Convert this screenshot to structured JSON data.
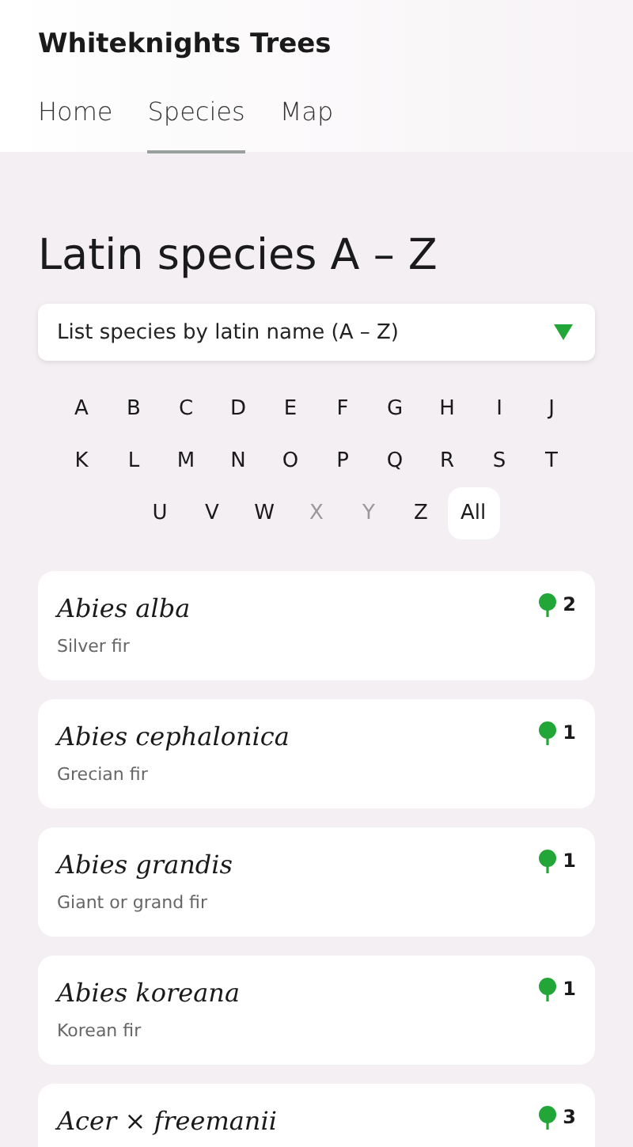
{
  "site_title": "Whiteknights Trees",
  "nav": [
    {
      "label": "Home",
      "selected": false
    },
    {
      "label": "Species",
      "selected": true
    },
    {
      "label": "Map",
      "selected": false
    }
  ],
  "heading": "Latin species A – Z",
  "sort_select": {
    "value": "List species by latin name (A – Z)"
  },
  "letters": [
    {
      "label": "A",
      "disabled": false,
      "selected": false
    },
    {
      "label": "B",
      "disabled": false,
      "selected": false
    },
    {
      "label": "C",
      "disabled": false,
      "selected": false
    },
    {
      "label": "D",
      "disabled": false,
      "selected": false
    },
    {
      "label": "E",
      "disabled": false,
      "selected": false
    },
    {
      "label": "F",
      "disabled": false,
      "selected": false
    },
    {
      "label": "G",
      "disabled": false,
      "selected": false
    },
    {
      "label": "H",
      "disabled": false,
      "selected": false
    },
    {
      "label": "I",
      "disabled": false,
      "selected": false
    },
    {
      "label": "J",
      "disabled": false,
      "selected": false
    },
    {
      "label": "K",
      "disabled": false,
      "selected": false
    },
    {
      "label": "L",
      "disabled": false,
      "selected": false
    },
    {
      "label": "M",
      "disabled": false,
      "selected": false
    },
    {
      "label": "N",
      "disabled": false,
      "selected": false
    },
    {
      "label": "O",
      "disabled": false,
      "selected": false
    },
    {
      "label": "P",
      "disabled": false,
      "selected": false
    },
    {
      "label": "Q",
      "disabled": false,
      "selected": false
    },
    {
      "label": "R",
      "disabled": false,
      "selected": false
    },
    {
      "label": "S",
      "disabled": false,
      "selected": false
    },
    {
      "label": "T",
      "disabled": false,
      "selected": false
    },
    {
      "label": "U",
      "disabled": false,
      "selected": false
    },
    {
      "label": "V",
      "disabled": false,
      "selected": false
    },
    {
      "label": "W",
      "disabled": false,
      "selected": false
    },
    {
      "label": "X",
      "disabled": true,
      "selected": false
    },
    {
      "label": "Y",
      "disabled": true,
      "selected": false
    },
    {
      "label": "Z",
      "disabled": false,
      "selected": false
    },
    {
      "label": "All",
      "disabled": false,
      "selected": true
    }
  ],
  "species": [
    {
      "latin": "Abies alba",
      "common": "Silver fir",
      "count": "2"
    },
    {
      "latin": "Abies cephalonica",
      "common": "Grecian fir",
      "count": "1"
    },
    {
      "latin": "Abies grandis",
      "common": "Giant or grand fir",
      "count": "1"
    },
    {
      "latin": "Abies koreana",
      "common": "Korean fir",
      "count": "1"
    },
    {
      "latin": "Acer × freemanii",
      "count": "3"
    }
  ]
}
